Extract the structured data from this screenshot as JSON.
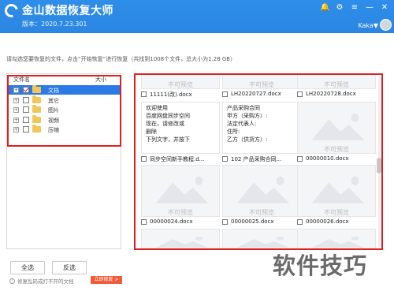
{
  "app": {
    "title": "金山数据恢复大师",
    "version": "版本：2020.7.23.301",
    "user": "Kaka▼",
    "brand_color": "#2c88e5"
  },
  "top_icons": [
    {
      "name": "bell-icon",
      "glyph": "🔔"
    },
    {
      "name": "settings-icon",
      "glyph": "⚙"
    },
    {
      "name": "menu-icon",
      "glyph": "≡"
    },
    {
      "name": "minimize-icon",
      "glyph": "—"
    },
    {
      "name": "close-icon",
      "glyph": "✕"
    }
  ],
  "info": "请勾选您要恢复的文件，点击“开始恢复”进行恢复（共找到1008个文件，总大小为1.28 GB）",
  "tree": {
    "header_name": "文件名",
    "header_size": "大小",
    "items": [
      {
        "label": "文档",
        "checked": true,
        "selected": true
      },
      {
        "label": "其它",
        "checked": false,
        "selected": false
      },
      {
        "label": "图片",
        "checked": false,
        "selected": false
      },
      {
        "label": "视频",
        "checked": false,
        "selected": false
      },
      {
        "label": "压缩",
        "checked": false,
        "selected": false
      }
    ]
  },
  "buttons": {
    "select_all": "全选",
    "invert": "反选"
  },
  "warning": {
    "text": "修复乱码或打不开的文档",
    "action": "立即修复 >"
  },
  "preview": {
    "no_preview": "不可预览",
    "cards": [
      {
        "name": "11111(改).docx",
        "type": "placeholder",
        "text": []
      },
      {
        "name": "LH20220727.docx",
        "type": "placeholder",
        "text": []
      },
      {
        "name": "LH20220728.docx",
        "type": "placeholder",
        "text": []
      },
      {
        "name": "同步空间新手教程.d...",
        "type": "doc",
        "text": [
          "欢迎使用",
          "百度网盘同步空间",
          "现在，请修改或",
          "删除",
          "下列文字，并按下"
        ]
      },
      {
        "name": "102    产品采购合同...",
        "type": "doc",
        "text": [
          "产品采购合同",
          "甲方（采购方）:",
          "法定代表人:",
          "住所:",
          "乙方（供货方）:"
        ]
      },
      {
        "name": "00000010.docx",
        "type": "placeholder",
        "text": []
      },
      {
        "name": "00000024.docx",
        "type": "placeholder",
        "text": []
      },
      {
        "name": "00000025.docx",
        "type": "placeholder",
        "text": []
      },
      {
        "name": "00000026.docx",
        "type": "placeholder",
        "text": []
      },
      {
        "name": "",
        "type": "placeholder",
        "text": []
      },
      {
        "name": "",
        "type": "placeholder",
        "text": []
      },
      {
        "name": "",
        "type": "placeholder",
        "text": []
      }
    ]
  },
  "watermark": "软件技巧"
}
